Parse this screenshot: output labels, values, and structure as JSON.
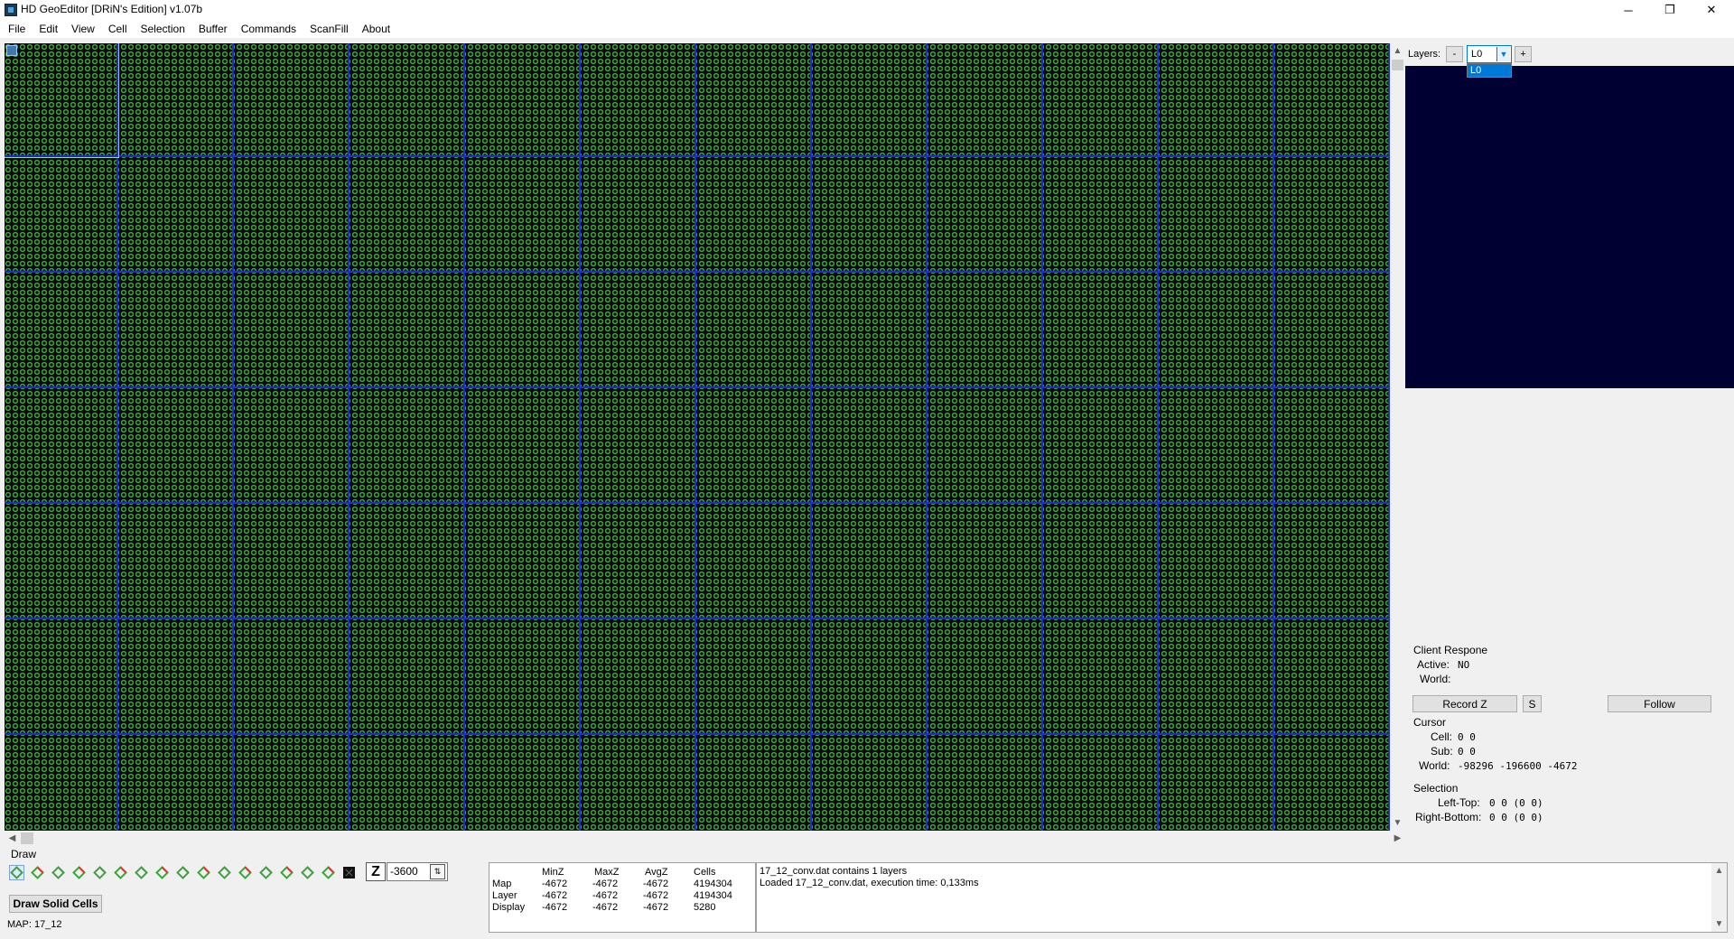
{
  "window": {
    "title": "HD GeoEditor [DRiN's Edition] v1.07b",
    "controls": {
      "minimize": "─",
      "restore": "❐",
      "close": "✕"
    }
  },
  "menu": [
    "File",
    "Edit",
    "View",
    "Cell",
    "Selection",
    "Buffer",
    "Commands",
    "ScanFill",
    "About"
  ],
  "colors": {
    "map_background": "#0d0d0d",
    "cell_ring": "#3fa33f",
    "grid_line": "#1a2fcf",
    "minimap_background": "#000033",
    "selection_highlight": "#0078d7"
  },
  "layers": {
    "label": "Layers:",
    "remove_label": "-",
    "add_label": "+",
    "selected": "L0",
    "options": [
      "L0"
    ]
  },
  "client_response": {
    "heading": "Client Respone",
    "active_label": "Active:",
    "active_value": "NO",
    "world_label": "World:",
    "world_value": ""
  },
  "buttons": {
    "record_z": "Record Z",
    "s": "S",
    "follow": "Follow",
    "draw_solid": "Draw Solid Cells"
  },
  "cursor": {
    "heading": "Cursor",
    "cell_label": "Cell:",
    "cell_value": "0 0",
    "sub_label": "Sub:",
    "sub_value": "0 0",
    "world_label": "World:",
    "world_value": "-98296 -196600 -4672"
  },
  "selection": {
    "heading": "Selection",
    "left_top_label": "Left-Top:",
    "left_top_value": "0 0  (0 0)",
    "right_bottom_label": "Right-Bottom:",
    "right_bottom_value": "0 0  (0 0)"
  },
  "draw": {
    "label": "Draw",
    "tool_icons": [
      "cell-full-icon",
      "cell-ne-icon",
      "cell-n-icon",
      "cell-nw-icon",
      "cell-e-icon",
      "cell-w-icon",
      "cell-s-icon",
      "cell-se-icon",
      "cell-sw-icon",
      "cell-ne-only-icon",
      "cell-nw-only-icon",
      "cell-se-only-icon",
      "cell-sw-only-icon",
      "cell-nsew-icon",
      "cell-ns-icon",
      "cell-ew-icon",
      "cell-empty-icon"
    ],
    "z_label": "Z",
    "z_value": "-3600"
  },
  "stats": {
    "headers": [
      "MinZ",
      "MaxZ",
      "AvgZ",
      "Cells"
    ],
    "rows": [
      {
        "label": "Map",
        "values": [
          "-4672",
          "-4672",
          "-4672",
          "4194304"
        ]
      },
      {
        "label": "Layer",
        "values": [
          "-4672",
          "-4672",
          "-4672",
          "4194304"
        ]
      },
      {
        "label": "Display",
        "values": [
          "-4672",
          "-4672",
          "-4672",
          "5280"
        ]
      }
    ]
  },
  "log": [
    "17_12_conv.dat contains 1 layers",
    "Loaded 17_12_conv.dat, execution time: 0,133ms"
  ],
  "status": {
    "map": "MAP: 17_12"
  }
}
